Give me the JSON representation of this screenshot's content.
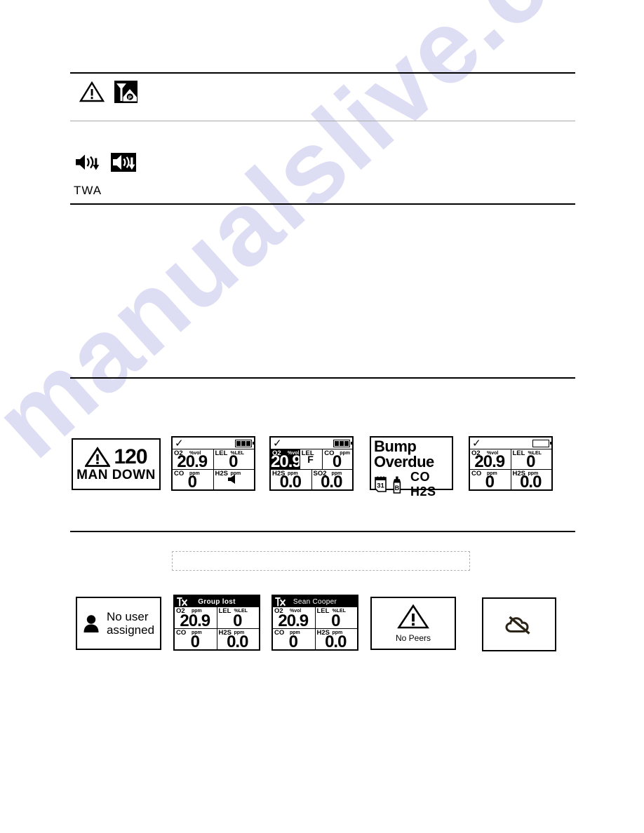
{
  "document": {
    "watermark": "manualslive.com"
  },
  "sections": {
    "alarm_icons": {
      "icons": [
        "warning-triangle-icon",
        "panic-alarm-icon"
      ]
    },
    "audio_icons": {
      "icons": [
        "speaker-down-icon",
        "speaker-down-inverted-icon"
      ],
      "label": "TWA"
    }
  },
  "screens_row1": [
    {
      "name": "man-down-screen",
      "type": "alert",
      "countdown": "120",
      "title": "MAN DOWN",
      "icon": "warning-triangle-icon"
    },
    {
      "name": "gas-reading-screen-4gas",
      "type": "lcd",
      "status": {
        "check": "✓",
        "battery_segments": 3,
        "battery_full": true
      },
      "cells": [
        {
          "gas": "O2",
          "unit": "%vol",
          "value": "20.9",
          "inverted": false
        },
        {
          "gas": "LEL",
          "unit": "%LEL",
          "value": "0",
          "inverted": false
        },
        {
          "gas": "CO",
          "unit": "ppm",
          "value": "0",
          "inverted": false
        },
        {
          "gas": "H2S",
          "unit": "ppm",
          "value": "",
          "icon": "speaker-icon",
          "inverted": false
        }
      ]
    },
    {
      "name": "gas-reading-screen-5gas-inverted",
      "type": "lcd",
      "status": {
        "check": "✓",
        "battery_segments": 3,
        "battery_full": true
      },
      "cells": [
        {
          "gas": "O2",
          "unit": "%vol",
          "value": "20.9",
          "inverted": true
        },
        {
          "gas": "LEL",
          "unit": "",
          "value": "F",
          "inverted": false
        },
        {
          "gas": "CO",
          "unit": "ppm",
          "value": "0",
          "inverted": false
        },
        {
          "gas": "H2S",
          "unit": "ppm",
          "value": "0.0",
          "inverted": false
        },
        {
          "gas": "SO2",
          "unit": "ppm",
          "value": "0.0",
          "inverted": false
        }
      ]
    },
    {
      "name": "bump-overdue-screen",
      "type": "alert",
      "title": "Bump Overdue",
      "icons": [
        "calendar-31-icon",
        "gas-cylinder-b-icon"
      ],
      "gases": "CO H2S",
      "calendar_day": "31",
      "cylinder_label": "B"
    },
    {
      "name": "gas-reading-screen-low-battery",
      "type": "lcd",
      "status": {
        "check": "✓",
        "battery_segments": 0,
        "battery_full": false
      },
      "cells": [
        {
          "gas": "O2",
          "unit": "%vol",
          "value": "20.9",
          "inverted": false
        },
        {
          "gas": "LEL",
          "unit": "%LEL",
          "value": "0",
          "inverted": false
        },
        {
          "gas": "CO",
          "unit": "ppm",
          "value": "0",
          "inverted": false
        },
        {
          "gas": "H2S",
          "unit": "ppm",
          "value": "0.0",
          "inverted": false
        }
      ]
    }
  ],
  "screens_row2": [
    {
      "name": "no-user-assigned-screen",
      "type": "alert",
      "icon": "user-icon",
      "line1": "No user",
      "line2": "assigned"
    },
    {
      "name": "group-lost-screen",
      "type": "lcd-tx",
      "tx_icon": "tx-no-signal-icon",
      "tx_label": "Group lost",
      "tx_bold": true,
      "cells": [
        {
          "gas": "O2",
          "unit": "ppm",
          "value": "20.9"
        },
        {
          "gas": "LEL",
          "unit": "%LEL",
          "value": "0"
        },
        {
          "gas": "CO",
          "unit": "ppm",
          "value": "0"
        },
        {
          "gas": "H2S",
          "unit": "ppm",
          "value": "0.0"
        }
      ]
    },
    {
      "name": "peer-name-screen",
      "type": "lcd-tx",
      "tx_icon": "tx-no-signal-icon",
      "tx_label": "Sean Cooper",
      "tx_bold": false,
      "cells": [
        {
          "gas": "O2",
          "unit": "%vol",
          "value": "20.9"
        },
        {
          "gas": "LEL",
          "unit": "%LEL",
          "value": "0"
        },
        {
          "gas": "CO",
          "unit": "ppm",
          "value": "0"
        },
        {
          "gas": "H2S",
          "unit": "ppm",
          "value": "0.0"
        }
      ]
    },
    {
      "name": "no-peers-screen",
      "type": "alert",
      "icon": "warning-triangle-icon",
      "title": "No Peers"
    },
    {
      "name": "no-cloud-connection-screen",
      "type": "alert",
      "icon": "cloud-slash-icon",
      "title": ""
    }
  ]
}
